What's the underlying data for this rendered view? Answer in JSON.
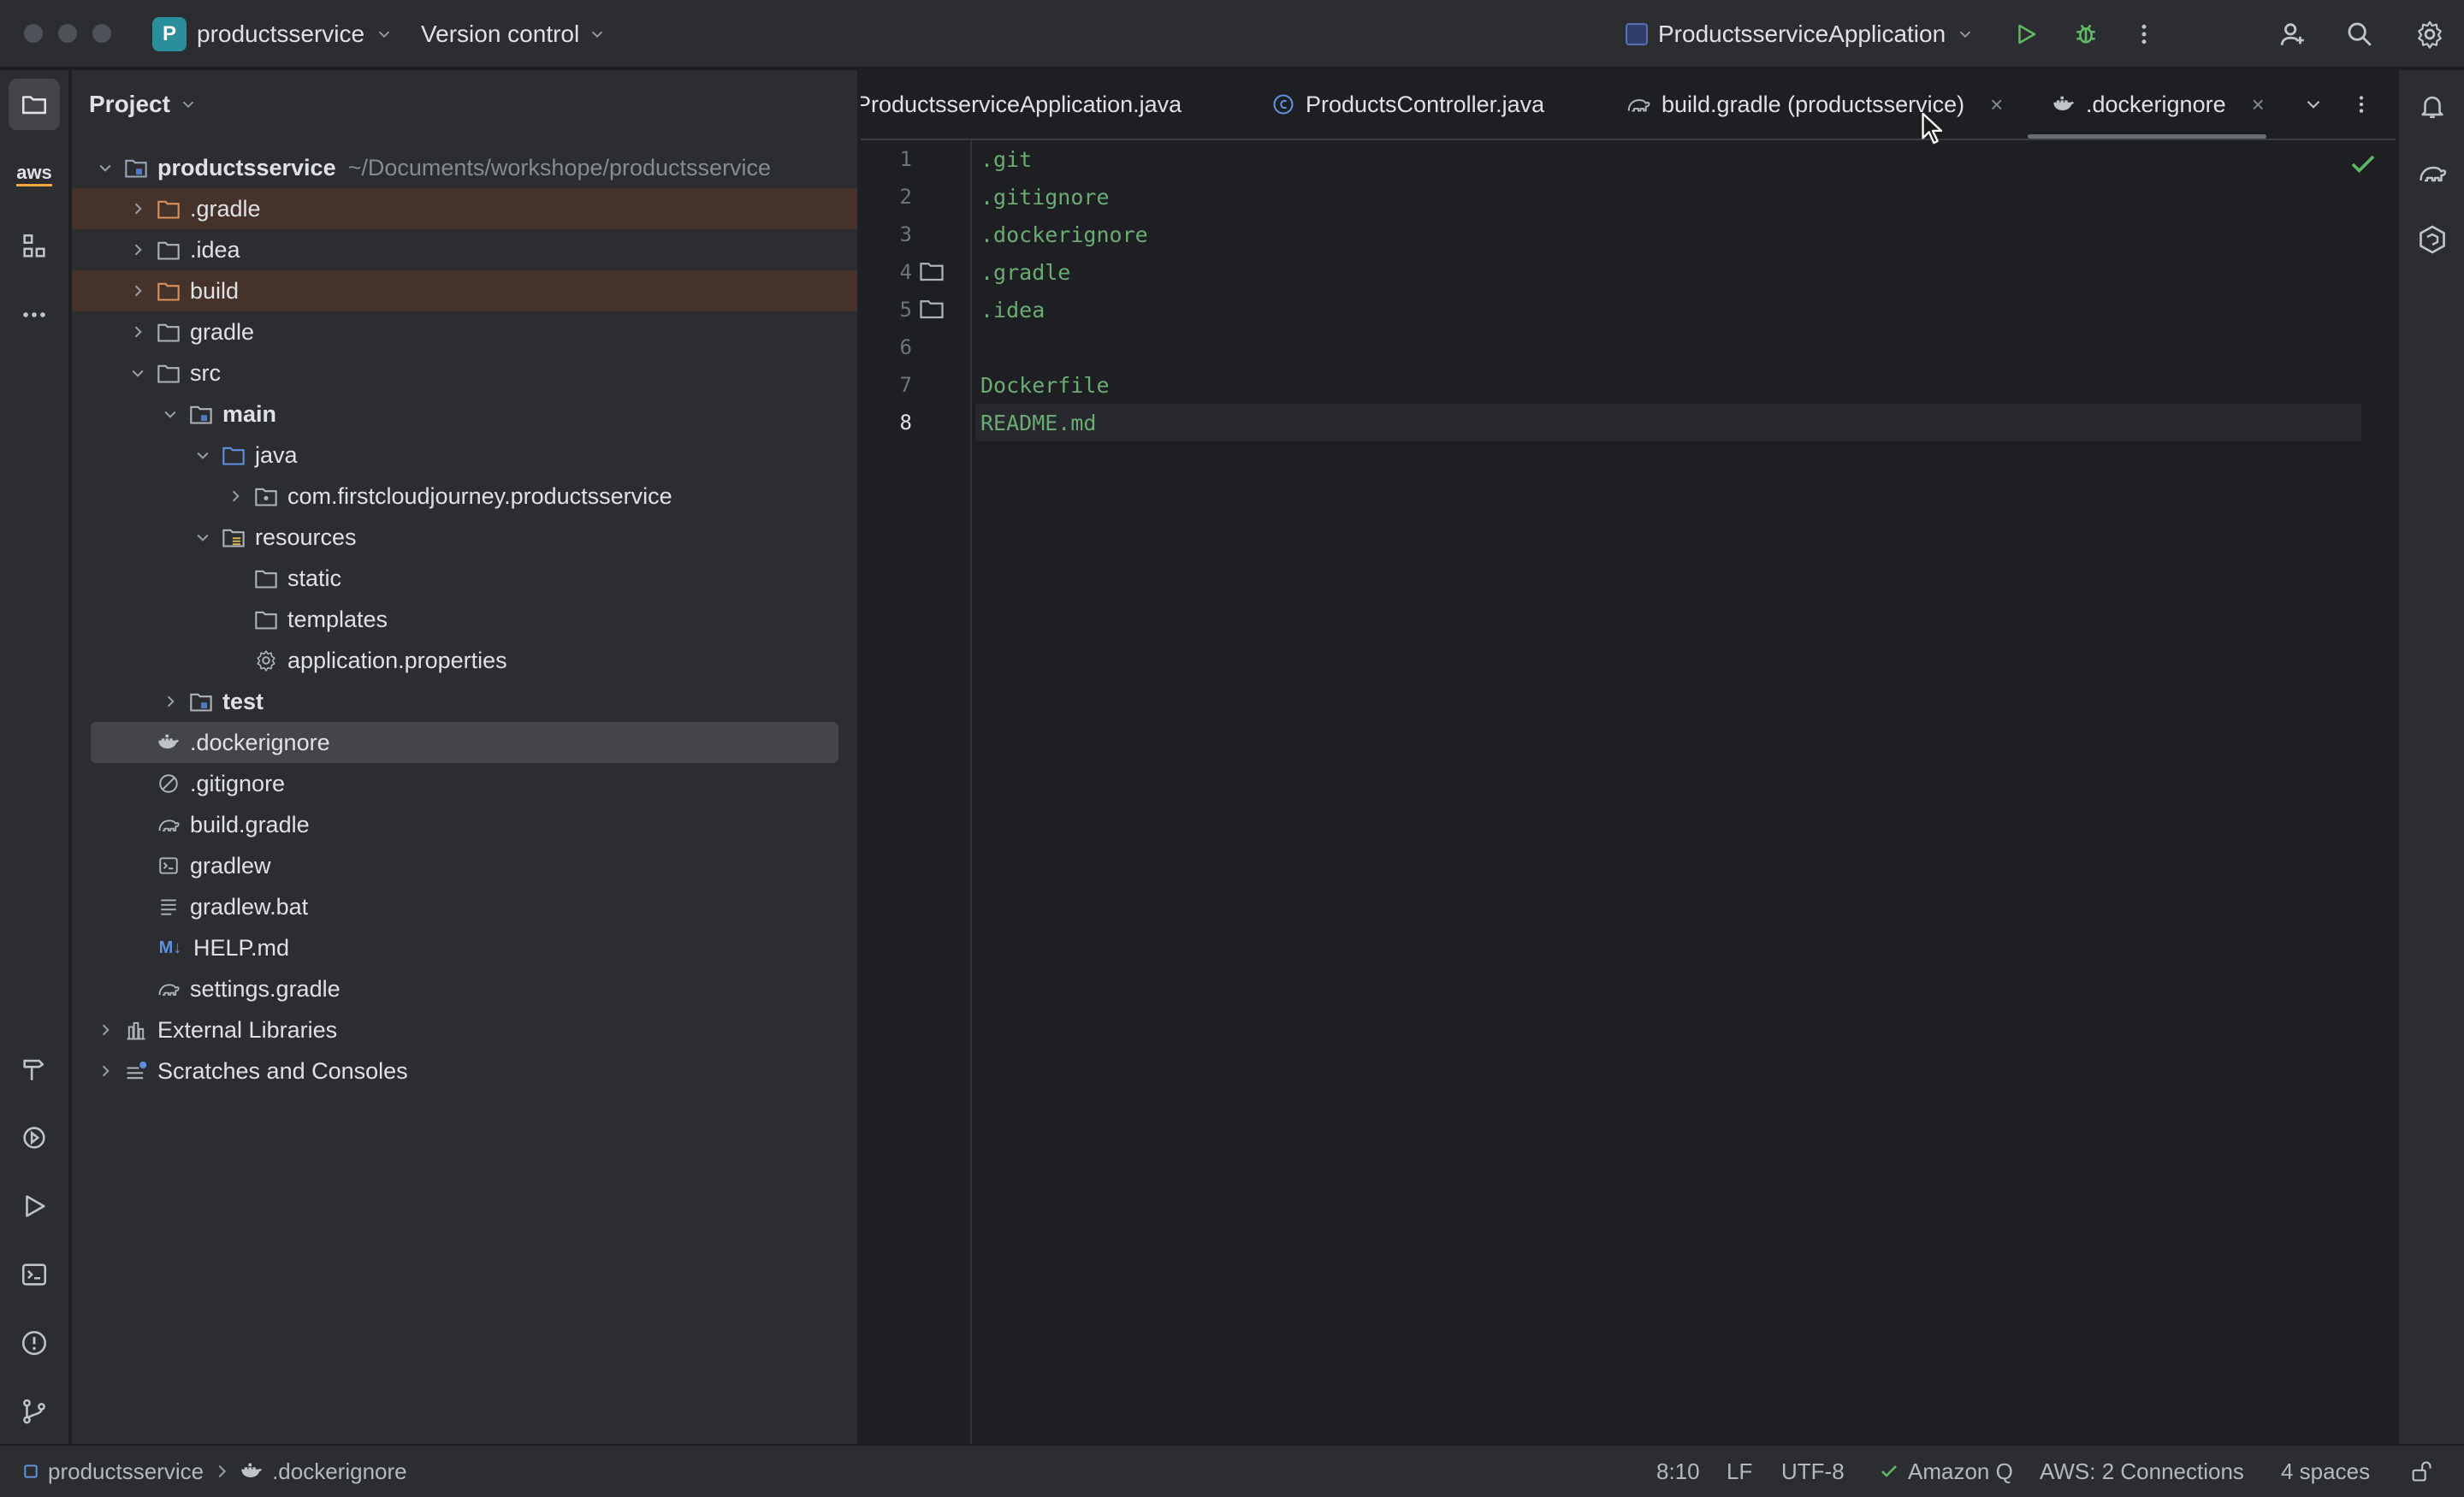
{
  "titlebar": {
    "project_initial": "P",
    "project_name": "productsservice",
    "version_control": "Version control",
    "run_config": "ProductsserviceApplication"
  },
  "project_panel": {
    "title": "Project",
    "root": {
      "name": "productsservice",
      "path": "~/Documents/workshope/productsservice"
    },
    "items": [
      {
        "label": ".gradle"
      },
      {
        "label": ".idea"
      },
      {
        "label": "build"
      },
      {
        "label": "gradle"
      },
      {
        "label": "src"
      },
      {
        "label": "main"
      },
      {
        "label": "java"
      },
      {
        "label": "com.firstcloudjourney.productsservice"
      },
      {
        "label": "resources"
      },
      {
        "label": "static"
      },
      {
        "label": "templates"
      },
      {
        "label": "application.properties"
      },
      {
        "label": "test"
      },
      {
        "label": ".dockerignore"
      },
      {
        "label": ".gitignore"
      },
      {
        "label": "build.gradle"
      },
      {
        "label": "gradlew"
      },
      {
        "label": "gradlew.bat"
      },
      {
        "label": "HELP.md"
      },
      {
        "label": "settings.gradle"
      },
      {
        "label": "External Libraries"
      },
      {
        "label": "Scratches and Consoles"
      }
    ],
    "md_icon_text": "M↓"
  },
  "tabs": [
    {
      "label": "ProductsserviceApplication.java"
    },
    {
      "label": "ProductsController.java"
    },
    {
      "label": "build.gradle (productsservice)"
    },
    {
      "label": ".dockerignore"
    }
  ],
  "tab_close": "×",
  "editor": {
    "lines": [
      {
        "num": "1",
        "text": ".git"
      },
      {
        "num": "2",
        "text": ".gitignore"
      },
      {
        "num": "3",
        "text": ".dockerignore"
      },
      {
        "num": "4",
        "text": ".gradle"
      },
      {
        "num": "5",
        "text": ".idea"
      },
      {
        "num": "6",
        "text": ""
      },
      {
        "num": "7",
        "text": "Dockerfile"
      },
      {
        "num": "8",
        "text": "README.md"
      }
    ],
    "current_line": 8
  },
  "aws_label": "aws",
  "statusbar": {
    "breadcrumb_project": "productsservice",
    "breadcrumb_file": ".dockerignore",
    "position": "8:10",
    "line_sep": "LF",
    "encoding": "UTF-8",
    "amazon_q": "Amazon Q",
    "aws_connections": "AWS: 2 Connections",
    "indent": "4 spaces"
  },
  "colors": {
    "accent_project": "#2a8f9a",
    "string_green": "#6aab73",
    "excluded_highlight": "#45322b",
    "folder_orange": "#d9935a",
    "run_green": "#5fb865"
  }
}
